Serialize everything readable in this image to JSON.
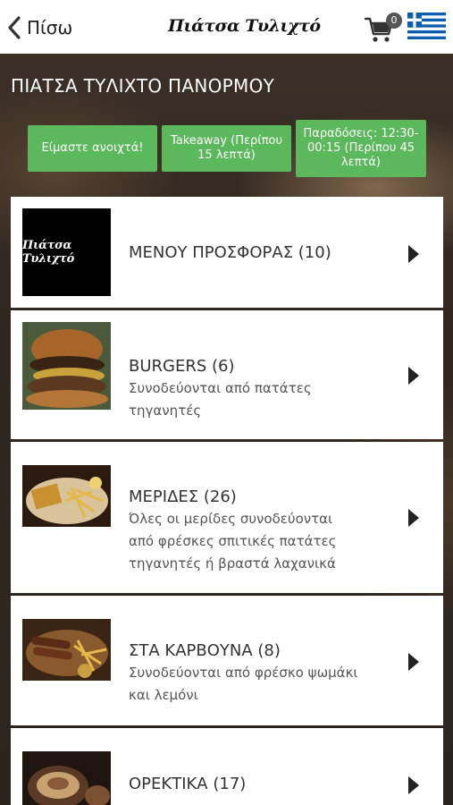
{
  "header": {
    "back_label": "Πίσω",
    "logo_text": "Πιάτσα Τυλιχτό",
    "cart_count": "0",
    "language": "Greek"
  },
  "restaurant": {
    "name": "ΠΙΑΤΣΑ ΤΥΛΙΧΤΟ ΠΑΝΟΡΜΟΥ"
  },
  "status": {
    "open": "Είμαστε ανοιχτά!",
    "takeaway": "Takeaway (Περίπου 15 λεπτά)",
    "delivery": "Παραδόσεις: 12:30-00:15 (Περίπου 45 λεπτά)",
    "accent": "#5cb85c"
  },
  "categories": [
    {
      "name": "ΜΕΝΟΥ ΠΡΟΣΦΟΡΑΣ",
      "count": "(10)",
      "title": "ΜΕΝΟΥ ΠΡΟΣΦΟΡΑΣ  (10)",
      "desc_lines": [],
      "thumb_text": "Πιάτσα Τυλιχτό"
    },
    {
      "name": "BURGERS",
      "count": "(6)",
      "title": "BURGERS  (6)",
      "desc_lines": [
        "Συνοδεύονται από πατάτες",
        "τηγανητές"
      ]
    },
    {
      "name": "ΜΕΡΙΔΕΣ",
      "count": "(26)",
      "title": "ΜΕΡΙΔΕΣ  (26)",
      "desc_lines": [
        "Όλες οι μερίδες συνοδεύονται",
        "από φρέσκες σπιτικές πατάτες",
        "τηγανητές ή βραστά λαχανικά"
      ]
    },
    {
      "name": "ΣΤΑ ΚΑΡΒΟΥΝΑ",
      "count": "(8)",
      "title": "ΣΤΑ ΚΑΡΒΟΥΝΑ  (8)",
      "desc_lines": [
        "Συνοδεύονται από φρέσκο ψωμάκι",
        "και λεμόνι"
      ]
    },
    {
      "name": "ΟΡΕΚΤΙΚΑ",
      "count": "(17)",
      "title": "ΟΡΕΚΤΙΚΑ  (17)",
      "desc_lines": []
    }
  ]
}
